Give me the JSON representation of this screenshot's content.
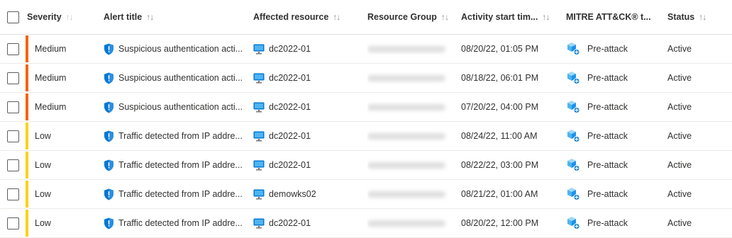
{
  "header": {
    "severity": "Severity",
    "alert_title": "Alert title",
    "affected_resource": "Affected resource",
    "resource_group": "Resource Group",
    "activity_start": "Activity start tim...",
    "mitre": "MITRE ATT&CK® t...",
    "status": "Status",
    "sort_glyph": "↑↓"
  },
  "colors": {
    "medium": "#f7630c",
    "low": "#fcd116",
    "shield": "#0078d4"
  },
  "rows": [
    {
      "severity": "Medium",
      "title": "Suspicious authentication acti...",
      "resource": "dc2022-01",
      "activity": "08/20/22, 01:05 PM",
      "mitre": "Pre-attack",
      "status": "Active"
    },
    {
      "severity": "Medium",
      "title": "Suspicious authentication acti...",
      "resource": "dc2022-01",
      "activity": "08/18/22, 06:01 PM",
      "mitre": "Pre-attack",
      "status": "Active"
    },
    {
      "severity": "Medium",
      "title": "Suspicious authentication acti...",
      "resource": "dc2022-01",
      "activity": "07/20/22, 04:00 PM",
      "mitre": "Pre-attack",
      "status": "Active"
    },
    {
      "severity": "Low",
      "title": "Traffic detected from IP addre...",
      "resource": "dc2022-01",
      "activity": "08/24/22, 11:00 AM",
      "mitre": "Pre-attack",
      "status": "Active"
    },
    {
      "severity": "Low",
      "title": "Traffic detected from IP addre...",
      "resource": "dc2022-01",
      "activity": "08/22/22, 03:00 PM",
      "mitre": "Pre-attack",
      "status": "Active"
    },
    {
      "severity": "Low",
      "title": "Traffic detected from IP addre...",
      "resource": "demowks02",
      "activity": "08/21/22, 01:00 AM",
      "mitre": "Pre-attack",
      "status": "Active"
    },
    {
      "severity": "Low",
      "title": "Traffic detected from IP addre...",
      "resource": "dc2022-01",
      "activity": "08/20/22, 12:00 PM",
      "mitre": "Pre-attack",
      "status": "Active"
    }
  ]
}
